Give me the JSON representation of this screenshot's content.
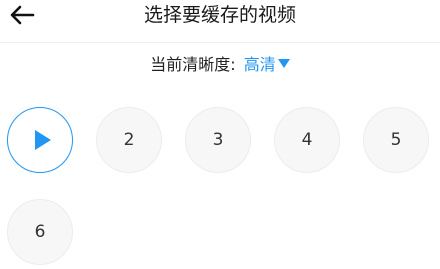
{
  "header": {
    "back_icon": "arrow-left-icon",
    "title": "选择要缓存的视频"
  },
  "quality": {
    "label": "当前清晰度:",
    "value": "高清",
    "dropdown_icon": "caret-down-icon",
    "accent_color": "#2196f3"
  },
  "episodes": [
    {
      "label": "",
      "state": "playing",
      "icon": "play-icon"
    },
    {
      "label": "2"
    },
    {
      "label": "3"
    },
    {
      "label": "4"
    },
    {
      "label": "5"
    },
    {
      "label": "6"
    }
  ]
}
